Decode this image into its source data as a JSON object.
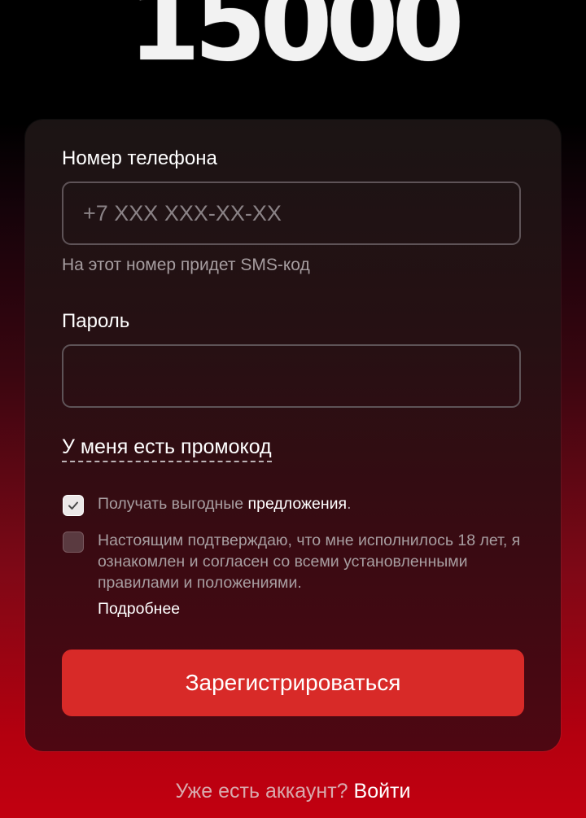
{
  "hero": {
    "number": "15000"
  },
  "form": {
    "phone_label": "Номер телефона",
    "phone_placeholder": "+7 XXX XXX-XX-XX",
    "phone_hint": "На этот номер придет SMS-код",
    "password_label": "Пароль",
    "password_value": "",
    "promo_link": "У меня есть промокод",
    "offers_checked": true,
    "offers_text": "Получать выгодные ",
    "offers_link": "предложения",
    "offers_end": ".",
    "age_checked": false,
    "age_text": "Настоящим подтверждаю, что мне исполнилось 18 лет, я ознакомлен и согласен со всеми установленными правилами и положениями.",
    "more_link": "Подробнее",
    "submit_label": "Зарегистрироваться"
  },
  "footer": {
    "question": "Уже есть аккаунт? ",
    "login_link": "Войти"
  },
  "colors": {
    "accent": "#d82a28",
    "background_top": "#000000",
    "background_bottom": "#c20010"
  }
}
